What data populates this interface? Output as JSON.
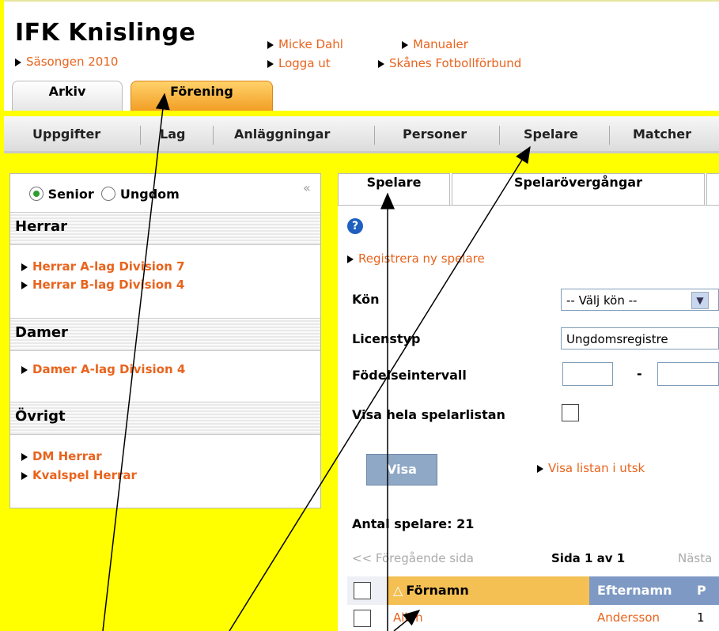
{
  "header": {
    "club_name": "IFK Knislinge",
    "season_link": "Säsongen 2010",
    "user_link": "Micke Dahl",
    "manuals_link": "Manualer",
    "logout_link": "Logga ut",
    "federation_link": "Skånes Fotbollförbund",
    "tabs": [
      {
        "label": "Arkiv",
        "active": false
      },
      {
        "label": "Förening",
        "active": true
      }
    ]
  },
  "nav": {
    "items": [
      "Uppgifter",
      "Lag",
      "Anläggningar",
      "Personer",
      "Spelare",
      "Matcher"
    ]
  },
  "sidebar": {
    "radio_senior": "Senior",
    "radio_ungdom": "Ungdom",
    "selected": "Senior",
    "collapse_glyph": "«",
    "sections": [
      {
        "title": "Herrar",
        "links": [
          "Herrar A-lag Division 7",
          "Herrar B-lag Division 4"
        ]
      },
      {
        "title": "Damer",
        "links": [
          "Damer A-lag Division 4"
        ]
      },
      {
        "title": "Övrigt",
        "links": [
          "DM Herrar",
          "Kvalspel Herrar"
        ]
      }
    ]
  },
  "main": {
    "tabs": [
      "Spelare",
      "Spelarövergångar"
    ],
    "help_glyph": "?",
    "register_link": "Registrera ny spelare",
    "form": {
      "gender_label": "Kön",
      "gender_value": "-- Välj kön --",
      "license_label": "Licenstyp",
      "license_value": "Ungdomsregistre",
      "birth_label": "Födelseintervall",
      "birth_from": "",
      "birth_dash": "-",
      "birth_to": "",
      "show_all_label": "Visa hela spelarlistan",
      "show_all_checked": false
    },
    "visa_button": "Visa",
    "print_link": "Visa listan i utsk",
    "count_text": "Antal spelare: 21",
    "pager": {
      "prev": "<< Föregående sida",
      "page": "Sida 1 av 1",
      "next": "Nästa"
    },
    "table": {
      "sort_glyph": "△",
      "columns": [
        "Förnamn",
        "Efternamn",
        "P"
      ],
      "rows": [
        {
          "first": "Albin",
          "last": "Andersson",
          "extra": "1"
        }
      ]
    }
  },
  "colors": {
    "page_bg": "#ffff00",
    "link": "#e8641e",
    "active_tab": "#f3a21d"
  }
}
